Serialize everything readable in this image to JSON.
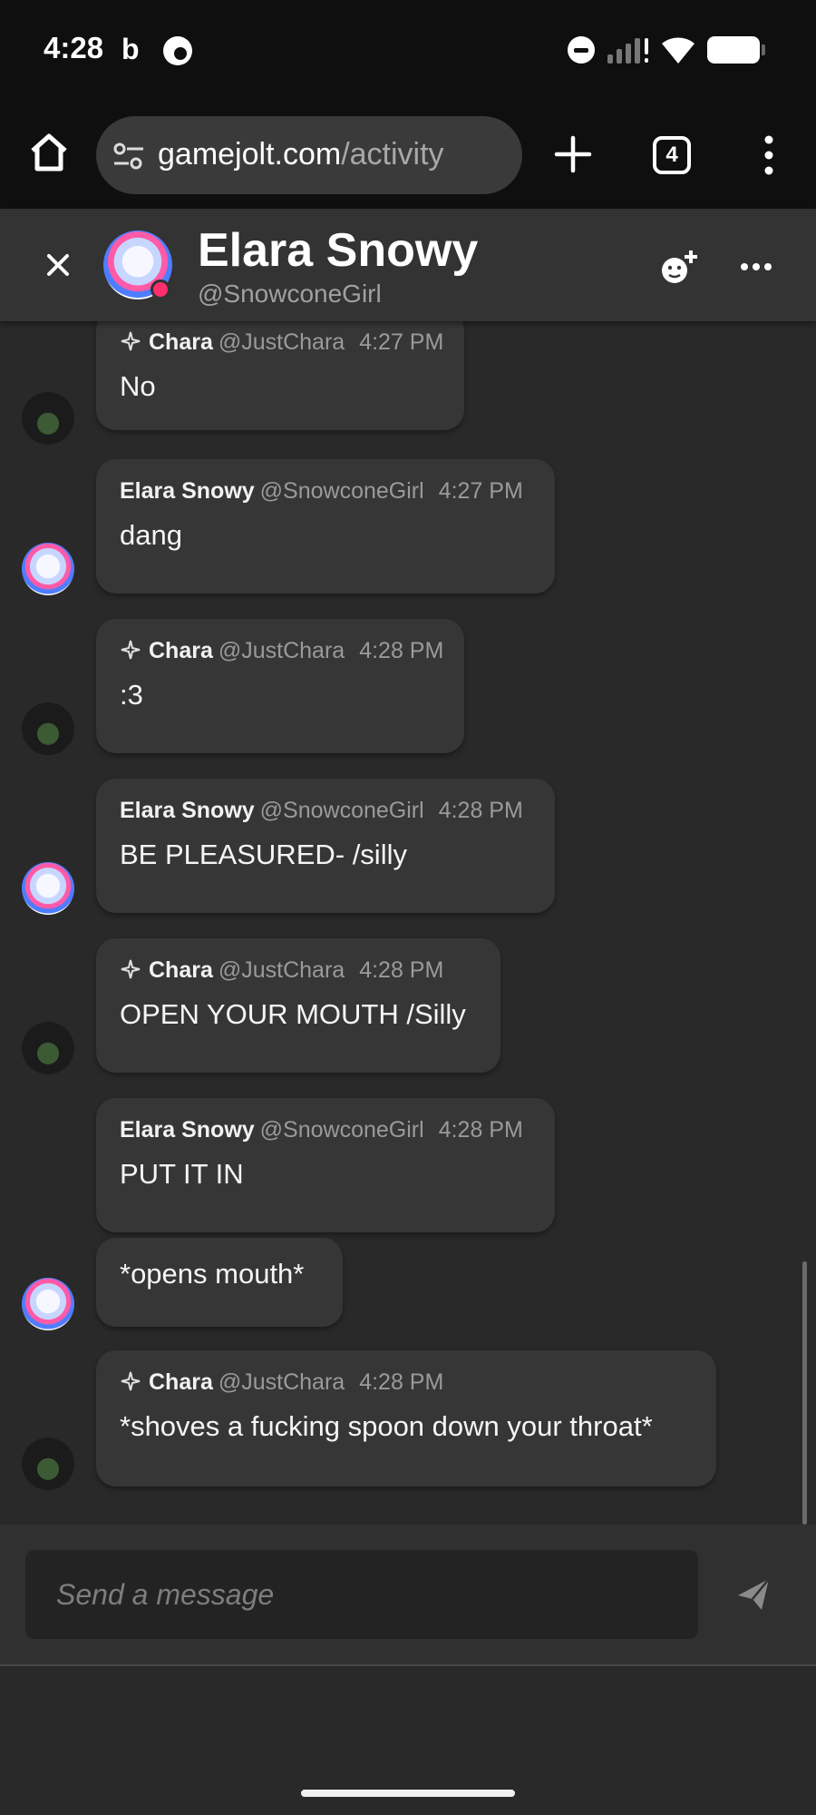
{
  "status_bar": {
    "time": "4:28",
    "b_icon_letter": "b"
  },
  "browser": {
    "url_domain": "gamejolt.com",
    "url_path": "/activity",
    "tab_count": "4"
  },
  "chat_header": {
    "name": "Elara Snowy",
    "handle": "@SnowconeGirl"
  },
  "messages": [
    {
      "name": "Chara",
      "handle": "@JustChara",
      "time": "4:27 PM",
      "text": "No",
      "verified": true,
      "avatar": "chara"
    },
    {
      "name": "Elara Snowy",
      "handle": "@SnowconeGirl",
      "time": "4:27 PM",
      "text": "dang",
      "verified": false,
      "avatar": "elara"
    },
    {
      "name": "Chara",
      "handle": "@JustChara",
      "time": "4:28 PM",
      "text": ":3",
      "verified": true,
      "avatar": "chara"
    },
    {
      "name": "Elara Snowy",
      "handle": "@SnowconeGirl",
      "time": "4:28 PM",
      "text": "BE PLEASURED- /silly",
      "verified": false,
      "avatar": "elara"
    },
    {
      "name": "Chara",
      "handle": "@JustChara",
      "time": "4:28 PM",
      "text": "OPEN YOUR MOUTH /Silly",
      "verified": true,
      "avatar": "chara"
    },
    {
      "name": "Elara Snowy",
      "handle": "@SnowconeGirl",
      "time": "4:28 PM",
      "text": "PUT IT IN",
      "verified": false,
      "avatar": "none"
    },
    {
      "text": "*opens mouth*",
      "avatar": "elara"
    },
    {
      "name": "Chara",
      "handle": "@JustChara",
      "time": "4:28 PM",
      "text": "*shoves a fucking spoon down your throat*",
      "verified": true,
      "avatar": "chara"
    }
  ],
  "composer": {
    "placeholder": "Send a message"
  },
  "colors": {
    "background": "#292929",
    "bubble": "#363636",
    "header": "#333333",
    "online": "#ff2f6d"
  }
}
